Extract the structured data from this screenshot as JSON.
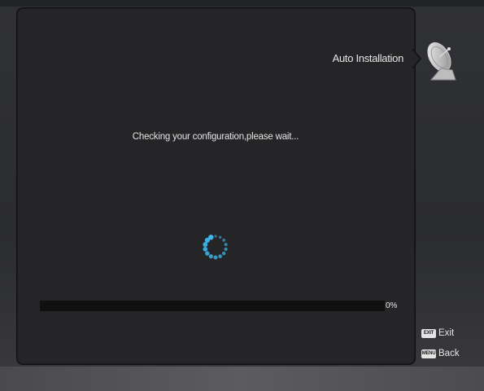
{
  "header": {
    "title": "Auto Installation",
    "icon": "satellite-dish-icon"
  },
  "main": {
    "status_message": "Checking your configuration,please wait...",
    "spinner_icon": "loading-spinner-icon"
  },
  "progress": {
    "percent_label": "0%",
    "fraction": 0,
    "fill_color": "#3fb7ee"
  },
  "keys": {
    "exit": {
      "badge": "EXIT",
      "label": "Exit"
    },
    "back": {
      "badge": "MENU",
      "label": "Back"
    }
  },
  "colors": {
    "panel": "#252528",
    "spinner": "#3fb7ee",
    "text": "#e6e6e6"
  }
}
